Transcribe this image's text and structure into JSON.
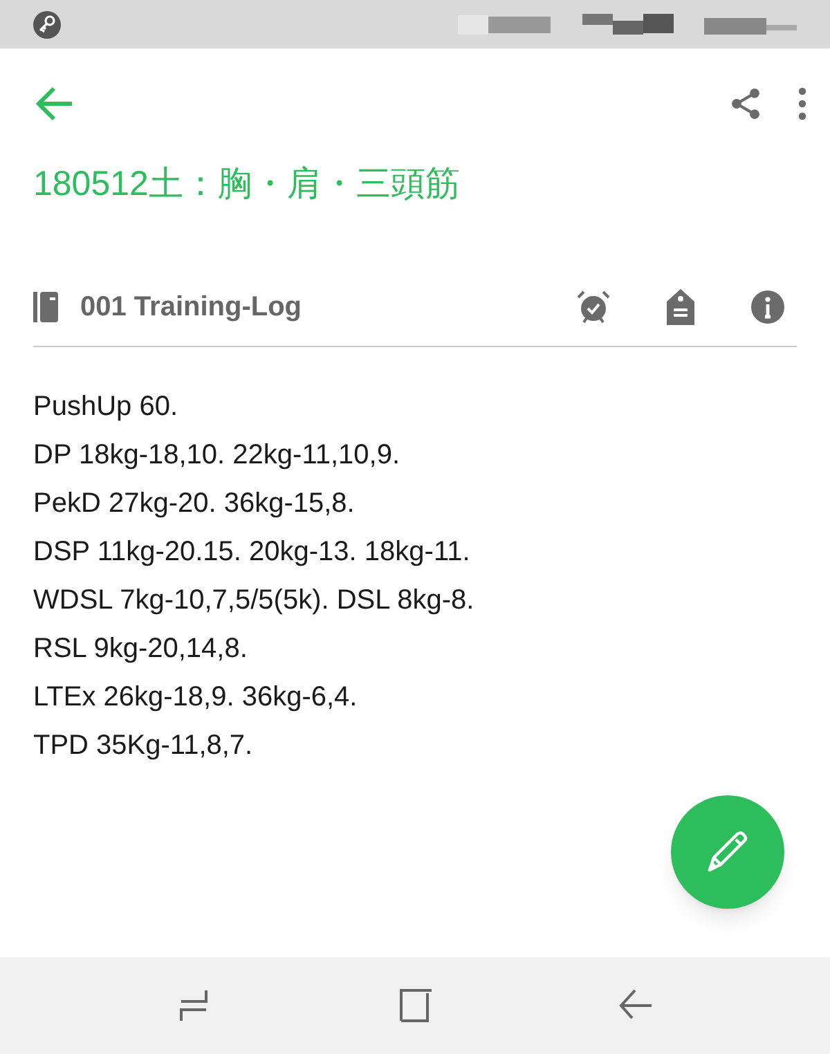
{
  "note": {
    "title": "180512土：胸・肩・三頭筋"
  },
  "notebook": {
    "name": "001 Training-Log"
  },
  "body": {
    "lines": [
      "PushUp 60.",
      "DP 18kg-18,10. 22kg-11,10,9.",
      "PekD 27kg-20. 36kg-15,8.",
      "DSP 11kg-20.15. 20kg-13. 18kg-11.",
      "WDSL 7kg-10,7,5/5(5k). DSL 8kg-8.",
      "RSL 9kg-20,14,8.",
      "LTEx 26kg-18,9. 36kg-6,4.",
      "TPD 35Kg-11,8,7."
    ]
  }
}
